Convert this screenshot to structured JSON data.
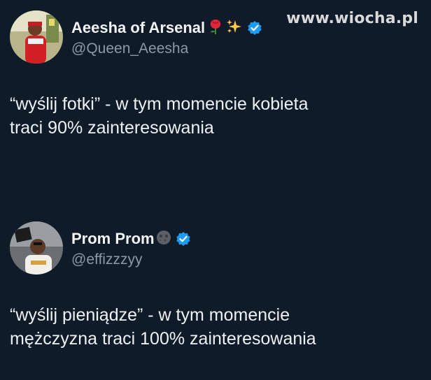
{
  "watermark": "www.wiocha.pl",
  "tweets": [
    {
      "display_name": "Aeesha of Arsenal",
      "handle": "@Queen_Aeesha",
      "emojis": [
        "rose-icon",
        "sparkles-icon"
      ],
      "verified": true,
      "text": "“wyślij fotki” - w tym momencie kobieta\ntraci 90% zainteresowania"
    },
    {
      "display_name": "Prom Prom",
      "handle": "@effizzzyy",
      "emojis": [
        "moon-face-icon"
      ],
      "verified": true,
      "text": "“wyślij pieniądze” - w tym momencie\nmężczyzna traci 100% zainteresowania"
    }
  ],
  "colors": {
    "background": "#0f1b29",
    "text": "#eef1f3",
    "handle": "#8b98a5",
    "verified": "#1d9bf0",
    "watermark": "#d9d9d9"
  }
}
